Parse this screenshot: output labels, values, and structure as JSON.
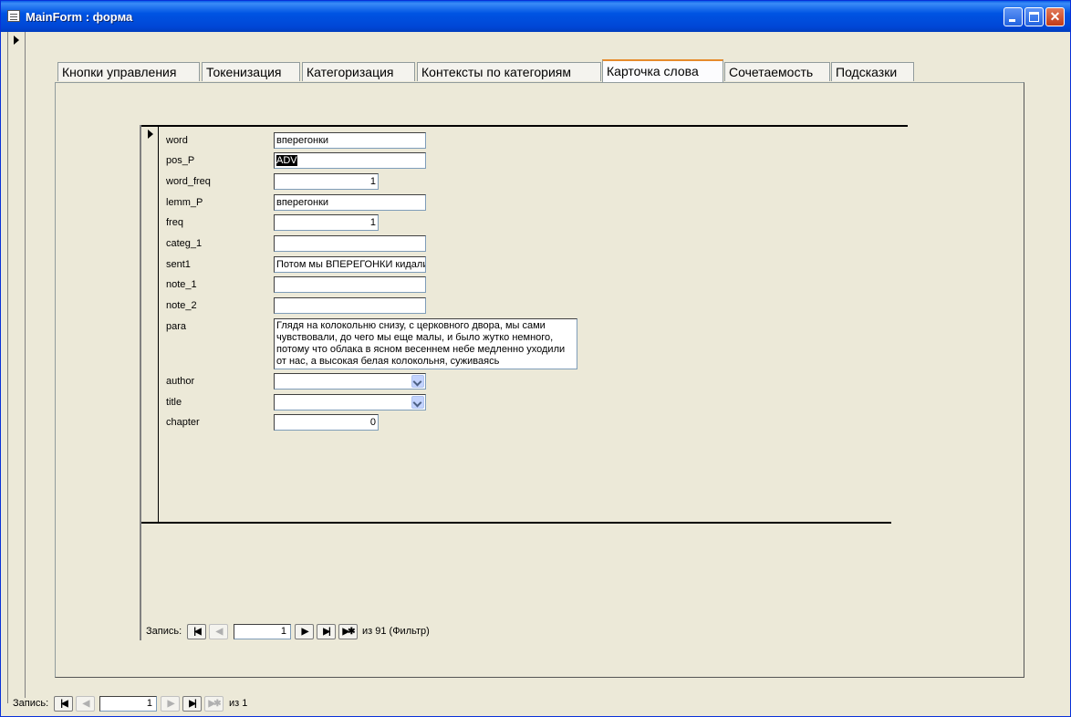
{
  "window": {
    "title": "MainForm : форма"
  },
  "tabs": [
    {
      "label": "Кнопки управления"
    },
    {
      "label": "Токенизация"
    },
    {
      "label": "Категоризация"
    },
    {
      "label": "Контексты по категориям"
    },
    {
      "label": "Карточка слова",
      "active": true
    },
    {
      "label": "Сочетаемость"
    },
    {
      "label": "Подсказки"
    }
  ],
  "fields": {
    "word": {
      "label": "word",
      "value": "вперегонки"
    },
    "pos_P": {
      "label": "pos_P",
      "value": "ADV"
    },
    "word_freq": {
      "label": "word_freq",
      "value": "1"
    },
    "lemm_P": {
      "label": "lemm_P",
      "value": "вперегонки"
    },
    "freq": {
      "label": "freq",
      "value": "1"
    },
    "categ_1": {
      "label": "categ_1",
      "value": ""
    },
    "sent1": {
      "label": "sent1",
      "value": "Потом мы ВПЕРЕГОНКИ кидались"
    },
    "note_1": {
      "label": "note_1",
      "value": ""
    },
    "note_2": {
      "label": "note_2",
      "value": ""
    },
    "para": {
      "label": "para",
      "value": "Глядя на колокольню снизу, с церковного двора, мы сами чувствовали, до чего мы еще малы, и было жутко немного, потому что облака в ясном весеннем небе медленно уходили от нас, а высокая белая колокольня, суживаясь"
    },
    "author": {
      "label": "author",
      "value": ""
    },
    "title": {
      "label": "title",
      "value": ""
    },
    "chapter": {
      "label": "chapter",
      "value": "0"
    }
  },
  "subform_nav": {
    "label": "Запись:",
    "current": "1",
    "of_text": "из  91 (Фильтр)"
  },
  "main_nav": {
    "label": "Запись:",
    "current": "1",
    "of_text": "из  1"
  },
  "colors": {
    "titlebar": "#0054e3",
    "form_bg": "#ece9d8",
    "active_tab_accent": "#e68b2c"
  }
}
